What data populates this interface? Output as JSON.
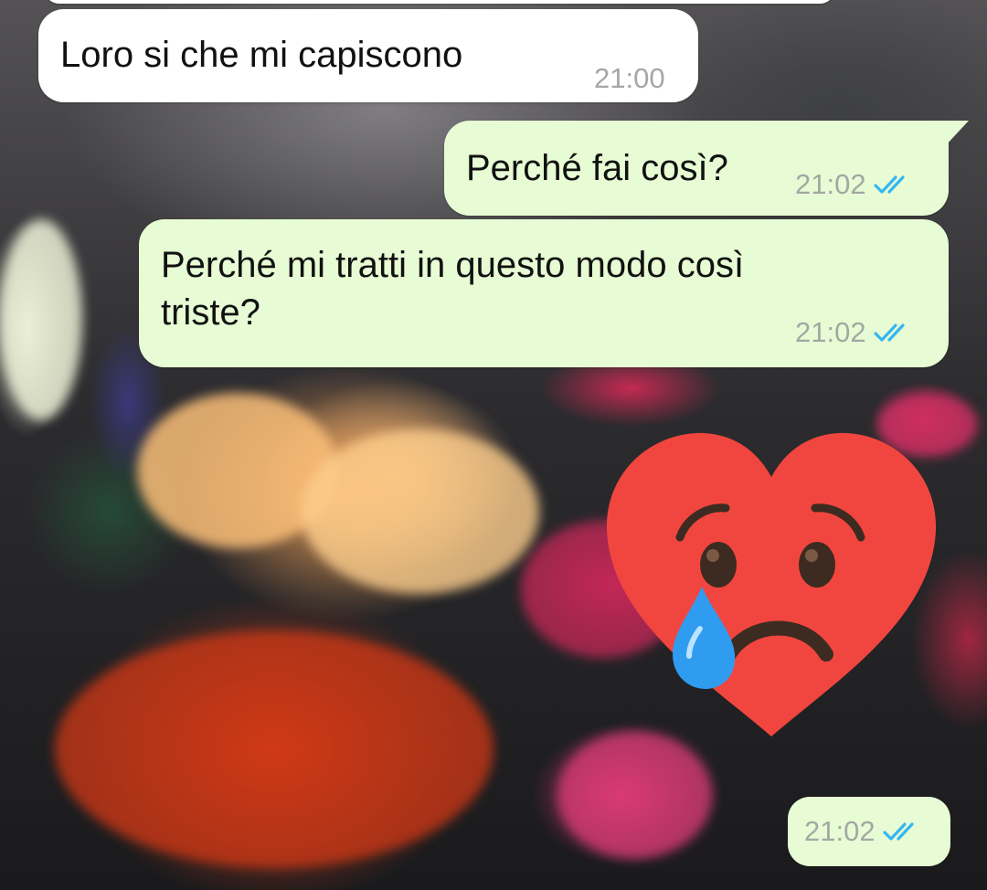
{
  "wallpaper": {
    "description_icon": "flower-bouquet-wallpaper"
  },
  "colors": {
    "incoming_bubble": "#ffffff",
    "outgoing_bubble": "#e7fcd4",
    "read_ticks": "#34b7f1",
    "timestamp": "#a3a8a3"
  },
  "messages": [
    {
      "direction": "incoming",
      "text": "Loro si che mi capiscono",
      "time": "21:00"
    },
    {
      "direction": "outgoing",
      "text": "Perché fai così?",
      "time": "21:02",
      "status_icon": "double-check-read-icon"
    },
    {
      "direction": "outgoing",
      "text": "Perché mi tratti in questo modo così\ntriste?",
      "time": "21:02",
      "status_icon": "double-check-read-icon"
    },
    {
      "direction": "outgoing",
      "type": "sticker",
      "sticker_icon": "crying-heart-sticker",
      "time": "21:02",
      "status_icon": "double-check-read-icon"
    }
  ]
}
